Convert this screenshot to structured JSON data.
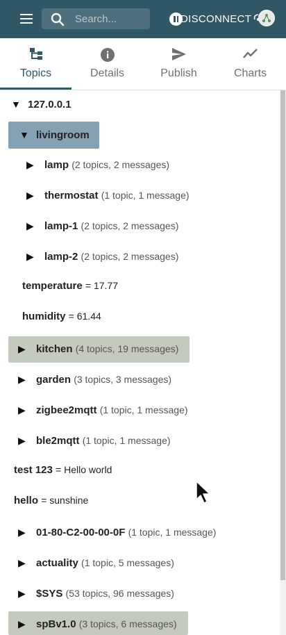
{
  "appbar": {
    "menu_icon": "menu-icon",
    "search_placeholder": "Search...",
    "disconnect_label": "DISCONNECT",
    "pause_icon": "pause-icon",
    "connection_icon": "connection-icon"
  },
  "tabs": [
    {
      "label": "Topics",
      "icon": "tree-icon",
      "active": true
    },
    {
      "label": "Details",
      "icon": "info-icon",
      "active": false
    },
    {
      "label": "Publish",
      "icon": "send-icon",
      "active": false
    },
    {
      "label": "Charts",
      "icon": "chart-icon",
      "active": false
    }
  ],
  "tree": {
    "root": {
      "arrow": "▼",
      "name": "127.0.0.1"
    },
    "livingroom": {
      "arrow": "▼",
      "name": "livingroom",
      "children": [
        {
          "arrow": "▶",
          "name": "lamp",
          "meta": "(2 topics, 2 messages)"
        },
        {
          "arrow": "▶",
          "name": "thermostat",
          "meta": "(1 topic, 1 message)"
        },
        {
          "arrow": "▶",
          "name": "lamp-1",
          "meta": "(2 topics, 2 messages)"
        },
        {
          "arrow": "▶",
          "name": "lamp-2",
          "meta": "(2 topics, 2 messages)"
        }
      ],
      "values": [
        {
          "name": "temperature",
          "value": "= 17.77"
        },
        {
          "name": "humidity",
          "value": "= 61.44"
        }
      ]
    },
    "nodes": [
      {
        "arrow": "▶",
        "name": "kitchen",
        "meta": "(4 topics, 19 messages)"
      },
      {
        "arrow": "▶",
        "name": "garden",
        "meta": "(3 topics, 3 messages)"
      },
      {
        "arrow": "▶",
        "name": "zigbee2mqtt",
        "meta": "(1 topic, 1 message)"
      },
      {
        "arrow": "▶",
        "name": "ble2mqtt",
        "meta": "(1 topic, 1 message)"
      }
    ],
    "leaves": [
      {
        "name": "test 123",
        "value": "= Hello world"
      },
      {
        "name": "hello",
        "value": "= sunshine"
      }
    ],
    "more_nodes": [
      {
        "arrow": "▶",
        "name": "01-80-C2-00-00-0F",
        "meta": "(1 topic, 1 message)"
      },
      {
        "arrow": "▶",
        "name": "actuality",
        "meta": "(1 topic, 5 messages)"
      },
      {
        "arrow": "▶",
        "name": "$SYS",
        "meta": "(53 topics, 96 messages)"
      },
      {
        "arrow": "▶",
        "name": "spBv1.0",
        "meta": "(3 topics, 6 messages)"
      }
    ]
  },
  "colors": {
    "appbar": "#2f5766",
    "selected_highlight": "#85a1b4",
    "recent_highlight": "#c5cabf"
  }
}
